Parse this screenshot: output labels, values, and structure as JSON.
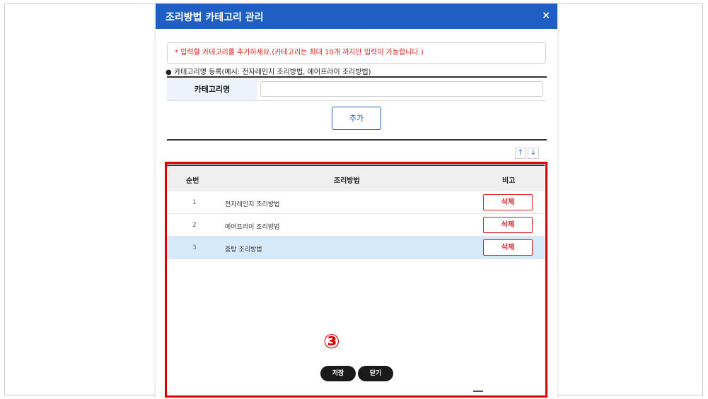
{
  "modal": {
    "title": "조리방법 카테고리 관리",
    "close": "×"
  },
  "notice": "* 입력할 카테고리를 추가하세요.(카테고리는 최대 10개 까지만 입력이 가능합니다.)",
  "register_hint": "● 카테고리명 등록(예시: 전자레인지 조리방법, 에어프라이 조리방법)",
  "form": {
    "label": "카테고리명",
    "input_value": "",
    "add_button": "추가"
  },
  "sort_buttons": {
    "up": "↑",
    "down": "↓"
  },
  "table": {
    "headers": [
      "순번",
      "조리방법",
      "비고"
    ],
    "rows": [
      {
        "no": "1",
        "name": "전자레인지 조리방법",
        "action": "삭제",
        "selected": false
      },
      {
        "no": "2",
        "name": "에어프라이 조리방법",
        "action": "삭제",
        "selected": false
      },
      {
        "no": "3",
        "name": "중탕 조리방법",
        "action": "삭제",
        "selected": true
      }
    ]
  },
  "annotation": {
    "marker": "③",
    "color": "#e00000"
  },
  "footer": {
    "save": "저장",
    "close": "닫기"
  },
  "colors": {
    "header": "#1f5fc4",
    "danger": "#e01c1c",
    "selected_row": "#d6e9fb"
  }
}
